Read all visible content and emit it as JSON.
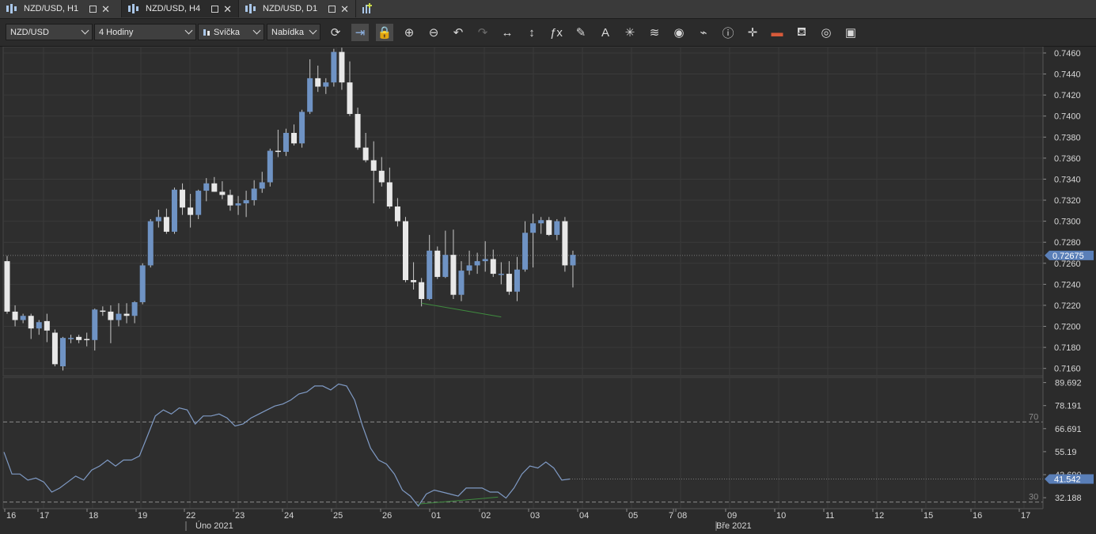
{
  "tabs": [
    {
      "label": "NZD/USD, H1",
      "active": false
    },
    {
      "label": "NZD/USD, H4",
      "active": true
    },
    {
      "label": "NZD/USD, D1",
      "active": false
    }
  ],
  "toolbar": {
    "symbol": "NZD/USD",
    "timeframe": "4 Hodiny",
    "chart_type": "Svíčka",
    "menu": "Nabídka",
    "buttons": [
      "refresh-icon",
      "autoscroll-icon",
      "lock-icon",
      "zoom-in-icon",
      "zoom-out-icon",
      "undo-icon",
      "redo-icon",
      "fit-horizontal-icon",
      "fit-vertical-icon",
      "indicators-fx-icon",
      "pencil-icon",
      "text-tool-icon",
      "crosshair-star-icon",
      "layers-icon",
      "eye-icon",
      "alert-icon",
      "info-icon",
      "cursor-cross-icon",
      "ruler-icon",
      "paint-bucket-icon",
      "lifebuoy-icon",
      "save-icon"
    ]
  },
  "colors": {
    "bull": "#6f93c4",
    "bear": "#e8e8e8",
    "rsi_line": "#7f9ac4",
    "price_tag": "#5a7fb8",
    "divergence": "#3f8b3f"
  },
  "chart_data": {
    "type": "candlestick",
    "symbol": "NZD/USD",
    "timeframe": "H4",
    "price_axis": {
      "ticks": [
        "0.7460",
        "0.7440",
        "0.7420",
        "0.7400",
        "0.7380",
        "0.7360",
        "0.7340",
        "0.7320",
        "0.7300",
        "0.7280",
        "0.7260",
        "0.7240",
        "0.7220",
        "0.7200",
        "0.7180",
        "0.7160"
      ],
      "range": [
        0.7153,
        0.7466
      ],
      "current_price": "0.72675",
      "current_value": 0.72675
    },
    "time_axis": {
      "labels": [
        "16",
        "17",
        "18",
        "19",
        "22",
        "23",
        "24",
        "25",
        "26",
        "01",
        "02",
        "03",
        "04",
        "05",
        "7",
        "08",
        "09",
        "10",
        "11",
        "12",
        "15",
        "16",
        "17"
      ],
      "months": [
        "Úno 2021",
        "Bře 2021"
      ]
    },
    "candles": [
      [
        0.7262,
        0.7267,
        0.7212,
        0.7214
      ],
      [
        0.7214,
        0.722,
        0.72,
        0.7206
      ],
      [
        0.7206,
        0.7212,
        0.7203,
        0.721
      ],
      [
        0.721,
        0.7212,
        0.7188,
        0.7198
      ],
      [
        0.7198,
        0.7206,
        0.7192,
        0.7204
      ],
      [
        0.7205,
        0.7212,
        0.7185,
        0.7196
      ],
      [
        0.7194,
        0.7197,
        0.7162,
        0.7164
      ],
      [
        0.7162,
        0.719,
        0.7158,
        0.7189
      ],
      [
        0.7189,
        0.7192,
        0.7184,
        0.7189
      ],
      [
        0.719,
        0.7192,
        0.7184,
        0.7187
      ],
      [
        0.7188,
        0.7194,
        0.7181,
        0.7187
      ],
      [
        0.7187,
        0.7217,
        0.7177,
        0.7216
      ],
      [
        0.7215,
        0.7219,
        0.721,
        0.7214
      ],
      [
        0.7214,
        0.722,
        0.7184,
        0.7206
      ],
      [
        0.7206,
        0.7222,
        0.72,
        0.7212
      ],
      [
        0.7212,
        0.7222,
        0.7203,
        0.721
      ],
      [
        0.721,
        0.7224,
        0.7203,
        0.7223
      ],
      [
        0.7223,
        0.726,
        0.7221,
        0.7258
      ],
      [
        0.7258,
        0.7302,
        0.7256,
        0.73
      ],
      [
        0.73,
        0.7311,
        0.7294,
        0.7304
      ],
      [
        0.7304,
        0.7312,
        0.7288,
        0.729
      ],
      [
        0.729,
        0.7332,
        0.7288,
        0.733
      ],
      [
        0.733,
        0.7336,
        0.7306,
        0.7313
      ],
      [
        0.7313,
        0.7326,
        0.7294,
        0.7306
      ],
      [
        0.7306,
        0.733,
        0.7302,
        0.7329
      ],
      [
        0.7329,
        0.7341,
        0.7319,
        0.7336
      ],
      [
        0.7336,
        0.7342,
        0.7328,
        0.7328
      ],
      [
        0.7328,
        0.7338,
        0.7321,
        0.7325
      ],
      [
        0.7325,
        0.733,
        0.731,
        0.7315
      ],
      [
        0.7315,
        0.7324,
        0.7306,
        0.7317
      ],
      [
        0.7317,
        0.7329,
        0.7304,
        0.732
      ],
      [
        0.732,
        0.7339,
        0.7315,
        0.7331
      ],
      [
        0.7331,
        0.7347,
        0.7327,
        0.7337
      ],
      [
        0.7337,
        0.7369,
        0.7333,
        0.7367
      ],
      [
        0.7367,
        0.7387,
        0.7361,
        0.7366
      ],
      [
        0.7366,
        0.7388,
        0.7362,
        0.7384
      ],
      [
        0.7384,
        0.7392,
        0.7372,
        0.7374
      ],
      [
        0.7374,
        0.7406,
        0.737,
        0.7404
      ],
      [
        0.7404,
        0.7454,
        0.7402,
        0.7436
      ],
      [
        0.7436,
        0.7448,
        0.7423,
        0.7428
      ],
      [
        0.7428,
        0.7436,
        0.7421,
        0.7432
      ],
      [
        0.7432,
        0.7464,
        0.7428,
        0.7461
      ],
      [
        0.7461,
        0.7465,
        0.7425,
        0.7432
      ],
      [
        0.7432,
        0.7452,
        0.74,
        0.7402
      ],
      [
        0.7402,
        0.7408,
        0.7368,
        0.737
      ],
      [
        0.737,
        0.7384,
        0.7356,
        0.7358
      ],
      [
        0.7358,
        0.7376,
        0.7317,
        0.7348
      ],
      [
        0.7348,
        0.7361,
        0.7333,
        0.7337
      ],
      [
        0.7337,
        0.7351,
        0.7312,
        0.7314
      ],
      [
        0.7314,
        0.7322,
        0.7295,
        0.73
      ],
      [
        0.73,
        0.7304,
        0.7242,
        0.7244
      ],
      [
        0.7244,
        0.7261,
        0.7235,
        0.7242
      ],
      [
        0.7242,
        0.7246,
        0.7219,
        0.7226
      ],
      [
        0.7226,
        0.7287,
        0.7225,
        0.7272
      ],
      [
        0.7272,
        0.7276,
        0.7245,
        0.7247
      ],
      [
        0.7247,
        0.7291,
        0.7246,
        0.7268
      ],
      [
        0.7268,
        0.7292,
        0.7226,
        0.723
      ],
      [
        0.723,
        0.7262,
        0.7224,
        0.7253
      ],
      [
        0.7253,
        0.7272,
        0.7249,
        0.7258
      ],
      [
        0.7258,
        0.727,
        0.725,
        0.7262
      ],
      [
        0.7262,
        0.7281,
        0.7252,
        0.7264
      ],
      [
        0.7264,
        0.7273,
        0.7247,
        0.725
      ],
      [
        0.725,
        0.7261,
        0.724,
        0.725
      ],
      [
        0.725,
        0.7262,
        0.723,
        0.7233
      ],
      [
        0.7233,
        0.7266,
        0.7224,
        0.7254
      ],
      [
        0.7254,
        0.73,
        0.7252,
        0.7289
      ],
      [
        0.7289,
        0.7307,
        0.7256,
        0.7298
      ],
      [
        0.7298,
        0.7304,
        0.7288,
        0.7301
      ],
      [
        0.7301,
        0.7304,
        0.7286,
        0.7287
      ],
      [
        0.7287,
        0.7302,
        0.7282,
        0.73
      ],
      [
        0.73,
        0.7304,
        0.7252,
        0.7258
      ],
      [
        0.7258,
        0.7272,
        0.7237,
        0.7268
      ]
    ],
    "divergence_price": [
      [
        52,
        0.7222
      ],
      [
        62,
        0.7209
      ]
    ],
    "rsi": {
      "ticks": [
        "89.692",
        "78.191",
        "66.691",
        "55.19",
        "43.690",
        "32.188"
      ],
      "range": [
        26.7,
        92.3
      ],
      "levels": [
        70,
        30
      ],
      "current": "41.542",
      "current_value": 41.542,
      "values": [
        55,
        44,
        44,
        41,
        42,
        40,
        35,
        37,
        40,
        43,
        41,
        46,
        48,
        51,
        48,
        51,
        51,
        53,
        63,
        73,
        76,
        74,
        77,
        76,
        69,
        73,
        73,
        74,
        72,
        68,
        69,
        72,
        74,
        76,
        78,
        79,
        81,
        84,
        85,
        88,
        88,
        86,
        89,
        88,
        81,
        68,
        57,
        51,
        49,
        44,
        36,
        33,
        28,
        34,
        36,
        35,
        34,
        33,
        37,
        37,
        37,
        35,
        35,
        32,
        37,
        44,
        48,
        47,
        50,
        47,
        41,
        41.5
      ],
      "divergence": [
        [
          52,
          29
        ],
        [
          62,
          32.5
        ]
      ]
    }
  }
}
